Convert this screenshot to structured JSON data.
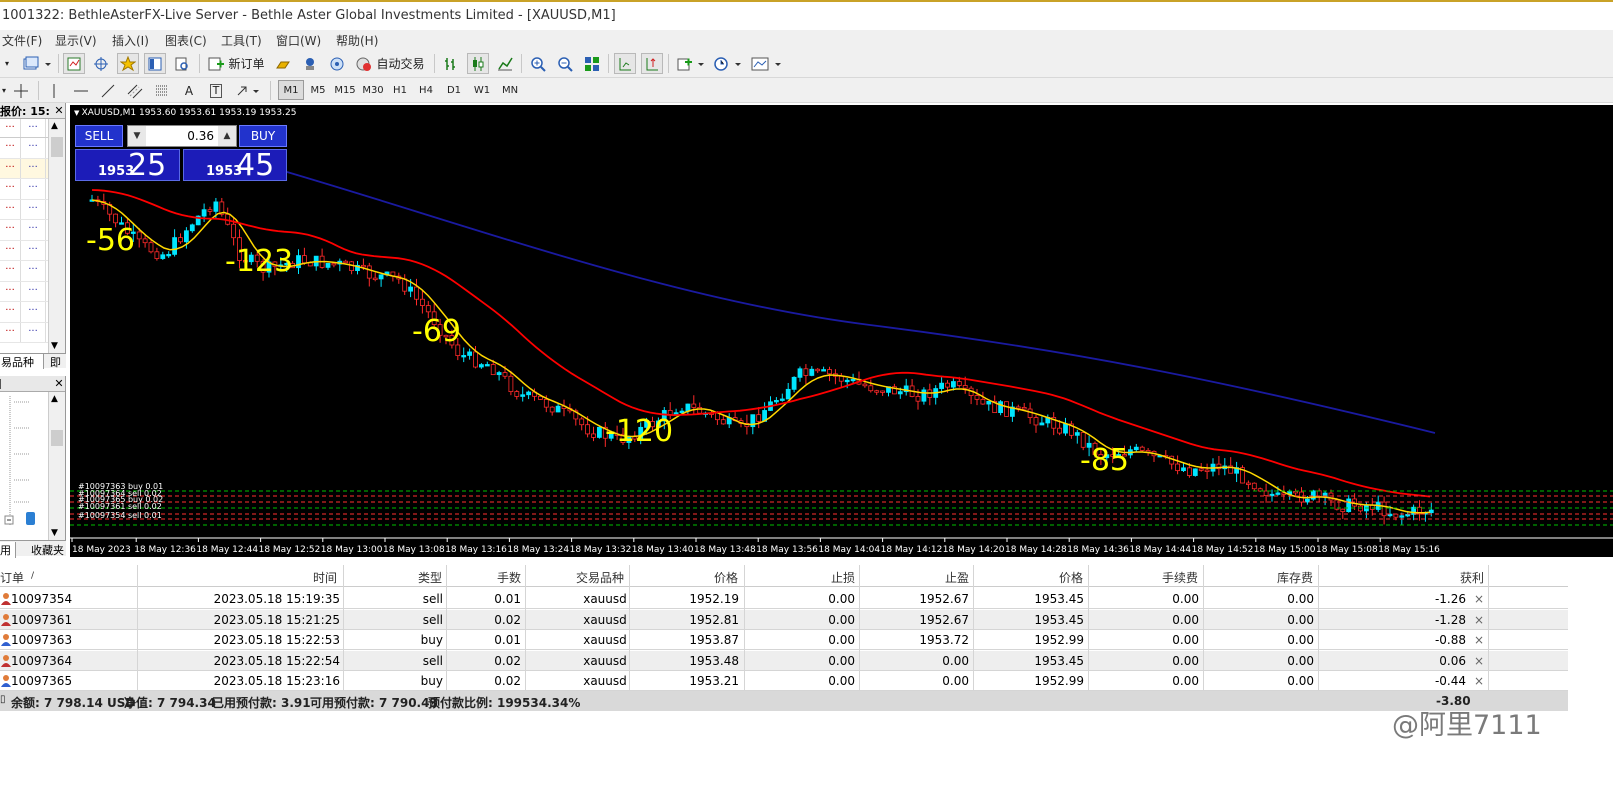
{
  "window": {
    "title": "1001322: BethleAsterFX-Live Server - Bethle Aster Global Investments Limited - [XAUUSD,M1]"
  },
  "menu": [
    "文件(F)",
    "显示(V)",
    "插入(I)",
    "图表(C)",
    "工具(T)",
    "窗口(W)",
    "帮助(H)"
  ],
  "toolbar": {
    "new_order": "新订单",
    "auto_trade": "自动交易",
    "timeframes": [
      "M1",
      "M5",
      "M15",
      "M30",
      "H1",
      "H4",
      "D1",
      "W1",
      "MN"
    ],
    "text_tool": "A",
    "label_tool": "T"
  },
  "market_watch": {
    "header": "报价: 15:",
    "tab_symbols": "易品种",
    "tab_other": "即",
    "row_mark": "..."
  },
  "navigator": {
    "tab_common": "用",
    "tab_favorites": "收藏夹"
  },
  "chart": {
    "title": "XAUUSD,M1  1953.60 1953.61 1953.19 1953.25",
    "trade_panel": {
      "sell_label": "SELL",
      "buy_label": "BUY",
      "lot": "0.36",
      "sell_price_small": "1953",
      "sell_price_big": "25",
      "buy_price_small": "1953",
      "buy_price_big": "45"
    },
    "order_labels": [
      "#10097363 buy 0.01",
      "#10097364 sell 0.02",
      "#10097365 buy 0.02",
      "#10097361 sell 0.02",
      "#10097354 sell 0.01"
    ],
    "annotations": [
      "-56",
      "-123",
      "-69",
      "-120",
      "-85"
    ],
    "time_labels": [
      "18 May 2023",
      "18 May 12:36",
      "18 May 12:44",
      "18 May 12:52",
      "18 May 13:00",
      "18 May 13:08",
      "18 May 13:16",
      "18 May 13:24",
      "18 May 13:32",
      "18 May 13:40",
      "18 May 13:48",
      "18 May 13:56",
      "18 May 14:04",
      "18 May 14:12",
      "18 May 14:20",
      "18 May 14:28",
      "18 May 14:36",
      "18 May 14:44",
      "18 May 14:52",
      "18 May 15:00",
      "18 May 15:08",
      "18 May 15:16"
    ],
    "colors": {
      "background": "#000000",
      "bull_candle": "#00e5ff",
      "bear_candle": "#ff2a2a",
      "ma_fast": "#ffd700",
      "ma_mid": "#ff0000",
      "ma_slow": "#1a1aa0",
      "order_line_buy": "#00c000",
      "order_line_sell": "#ff3030"
    }
  },
  "terminal": {
    "headers": {
      "order": "订单",
      "sort": "/",
      "time": "时间",
      "type": "类型",
      "volume": "手数",
      "symbol": "交易品种",
      "price": "价格",
      "sl": "止损",
      "tp": "止盈",
      "price2": "价格",
      "commission": "手续费",
      "swap": "库存费",
      "profit": "获利"
    },
    "rows": [
      {
        "order": "10097354",
        "time": "2023.05.18 15:19:35",
        "type": "sell",
        "volume": "0.01",
        "symbol": "xauusd",
        "price": "1952.19",
        "sl": "0.00",
        "tp": "1952.67",
        "price2": "1953.45",
        "commission": "0.00",
        "swap": "0.00",
        "profit": "-1.26",
        "close": "×"
      },
      {
        "order": "10097361",
        "time": "2023.05.18 15:21:25",
        "type": "sell",
        "volume": "0.02",
        "symbol": "xauusd",
        "price": "1952.81",
        "sl": "0.00",
        "tp": "1952.67",
        "price2": "1953.45",
        "commission": "0.00",
        "swap": "0.00",
        "profit": "-1.28",
        "close": "×"
      },
      {
        "order": "10097363",
        "time": "2023.05.18 15:22:53",
        "type": "buy",
        "volume": "0.01",
        "symbol": "xauusd",
        "price": "1953.87",
        "sl": "0.00",
        "tp": "1953.72",
        "price2": "1952.99",
        "commission": "0.00",
        "swap": "0.00",
        "profit": "-0.88",
        "close": "×"
      },
      {
        "order": "10097364",
        "time": "2023.05.18 15:22:54",
        "type": "sell",
        "volume": "0.02",
        "symbol": "xauusd",
        "price": "1953.48",
        "sl": "0.00",
        "tp": "0.00",
        "price2": "1953.45",
        "commission": "0.00",
        "swap": "0.00",
        "profit": "0.06",
        "close": "×"
      },
      {
        "order": "10097365",
        "time": "2023.05.18 15:23:16",
        "type": "buy",
        "volume": "0.02",
        "symbol": "xauusd",
        "price": "1953.21",
        "sl": "0.00",
        "tp": "0.00",
        "price2": "1952.99",
        "commission": "0.00",
        "swap": "0.00",
        "profit": "-0.44",
        "close": "×"
      }
    ],
    "summary": {
      "balance": "余额: 7 798.14 USD",
      "equity": "净值: 7 794.34",
      "margin": "已用预付款: 3.91",
      "free_margin": "可用预付款: 7 790.43",
      "margin_level": "预付款比例: 199534.34%",
      "total_profit": "-3.80"
    }
  },
  "watermark": "@阿里7111"
}
